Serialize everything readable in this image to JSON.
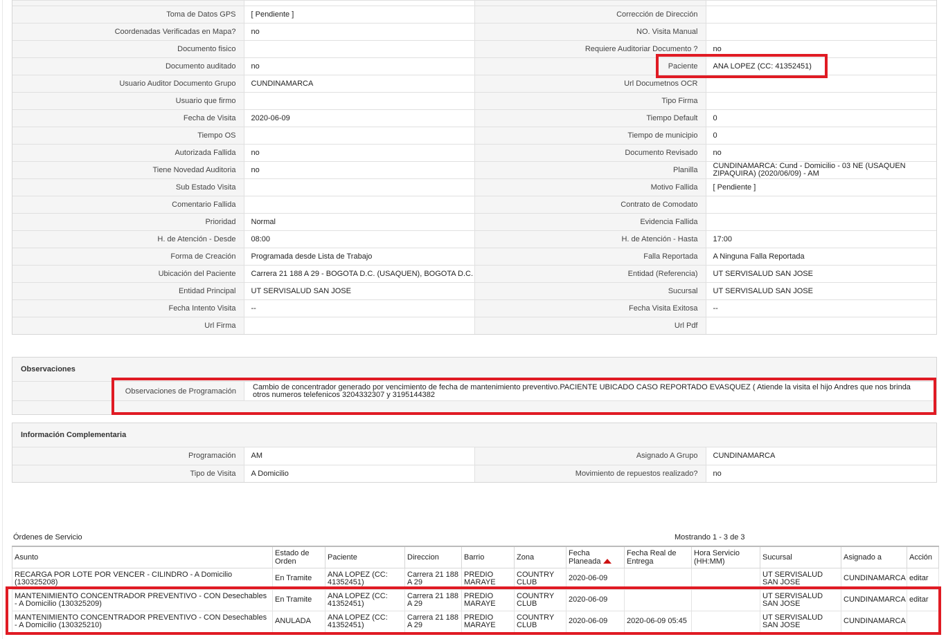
{
  "details": [
    {
      "l1": "Toma de Datos GPS",
      "v1": "[ Pendiente ]",
      "l2": "Corrección de Dirección",
      "v2": ""
    },
    {
      "l1": "Coordenadas Verificadas en Mapa?",
      "v1": "no",
      "l2": "NO. Visita Manual",
      "v2": ""
    },
    {
      "l1": "Documento fisico",
      "v1": "",
      "l2": "Requiere Auditoriar Documento ?",
      "v2": "no"
    },
    {
      "l1": "Documento auditado",
      "v1": "no",
      "l2": "Paciente",
      "v2": "ANA LOPEZ (CC: 41352451)"
    },
    {
      "l1": "Usuario Auditor Documento Grupo",
      "v1": "CUNDINAMARCA",
      "l2": "Url Documetnos OCR",
      "v2": ""
    },
    {
      "l1": "Usuario que firmo",
      "v1": "",
      "l2": "Tipo Firma",
      "v2": ""
    },
    {
      "l1": "Fecha de Visita",
      "v1": "2020-06-09",
      "l2": "Tiempo Default",
      "v2": "0"
    },
    {
      "l1": "Tiempo OS",
      "v1": "",
      "l2": "Tiempo de municipio",
      "v2": "0"
    },
    {
      "l1": "Autorizada Fallida",
      "v1": "no",
      "l2": "Documento Revisado",
      "v2": "no"
    },
    {
      "l1": "Tiene Novedad Auditoria",
      "v1": "no",
      "l2": "Planilla",
      "v2": "CUNDINAMARCA: Cund - Domicilio - 03 NE (USAQUEN ZIPAQUIRA) (2020/06/09) - AM"
    },
    {
      "l1": "Sub Estado Visita",
      "v1": "",
      "l2": "Motivo Fallida",
      "v2": "[ Pendiente ]"
    },
    {
      "l1": "Comentario Fallida",
      "v1": "",
      "l2": "Contrato de Comodato",
      "v2": ""
    },
    {
      "l1": "Prioridad",
      "v1": "Normal",
      "l2": "Evidencia Fallida",
      "v2": ""
    },
    {
      "l1": "H. de Atención - Desde",
      "v1": "08:00",
      "l2": "H. de Atención - Hasta",
      "v2": "17:00"
    },
    {
      "l1": "Forma de Creación",
      "v1": "Programada desde Lista de Trabajo",
      "l2": "Falla Reportada",
      "v2": "A Ninguna Falla Reportada"
    },
    {
      "l1": "Ubicación del Paciente",
      "v1": "Carrera 21 188 A 29 - BOGOTA D.C. (USAQUEN), BOGOTA D.C.",
      "l2": "Entidad (Referencia)",
      "v2": "UT SERVISALUD SAN JOSE"
    },
    {
      "l1": "Entidad Principal",
      "v1": "UT SERVISALUD SAN JOSE",
      "l2": "Sucursal",
      "v2": "UT SERVISALUD SAN JOSE"
    },
    {
      "l1": "Fecha Intento Visita",
      "v1": "--",
      "l2": "Fecha Visita Exitosa",
      "v2": "--"
    },
    {
      "l1": "Url Firma",
      "v1": "",
      "l2": "Url Pdf",
      "v2": ""
    }
  ],
  "observaciones": {
    "title": "Observaciones",
    "label": "Observaciones de Programación",
    "value": "Cambio de concentrador generado por vencimiento de fecha de mantenimiento preventivo.PACIENTE UBICADO CASO REPORTADO EVASQUEZ ( Atiende la visita el hijo Andres que nos brinda otros numeros telefenicos 3204332307 y 3195144382"
  },
  "complementaria": {
    "title": "Información Complementaria",
    "rows": [
      {
        "l1": "Programación",
        "v1": "AM",
        "l2": "Asignado A Grupo",
        "v2": "CUNDINAMARCA"
      },
      {
        "l1": "Tipo de Visita",
        "v1": "A Domicilio",
        "l2": "Movimiento de repuestos realizado?",
        "v2": "no"
      }
    ]
  },
  "orders": {
    "title": "Órdenes de Servicio",
    "count": "Mostrando 1 - 3 de 3",
    "columns": [
      "Asunto",
      "Estado de Orden",
      "Paciente",
      "Direccion",
      "Barrio",
      "Zona",
      "Fecha Planeada",
      "Fecha Real de Entrega",
      "Hora Servicio (HH:MM)",
      "Sucursal",
      "Asignado a",
      "Acción"
    ],
    "rows": [
      [
        "RECARGA POR LOTE POR VENCER - CILINDRO - A Domicilio (130325208)",
        "En Tramite",
        "ANA LOPEZ (CC: 41352451)",
        "Carrera 21 188 A 29",
        "PREDIO MARAYE",
        "COUNTRY CLUB",
        "2020-06-09",
        "",
        "",
        "UT SERVISALUD SAN JOSE",
        "CUNDINAMARCA",
        "editar"
      ],
      [
        "MANTENIMIENTO CONCENTRADOR PREVENTIVO - CON Desechables - A Domicilio (130325209)",
        "En Tramite",
        "ANA LOPEZ (CC: 41352451)",
        "Carrera 21 188 A 29",
        "PREDIO MARAYE",
        "COUNTRY CLUB",
        "2020-06-09",
        "",
        "",
        "UT SERVISALUD SAN JOSE",
        "CUNDINAMARCA",
        "editar"
      ],
      [
        "MANTENIMIENTO CONCENTRADOR PREVENTIVO - CON Desechables - A Domicilio (130325210)",
        "ANULADA",
        "ANA LOPEZ (CC: 41352451)",
        "Carrera 21 188 A 29",
        "PREDIO MARAYE",
        "COUNTRY CLUB",
        "2020-06-09",
        "2020-06-09 05:45",
        "",
        "UT SERVISALUD SAN JOSE",
        "CUNDINAMARCA",
        ""
      ]
    ]
  },
  "colors": {
    "highlight": "#e01b24",
    "sort_arrow": "#cc1111"
  }
}
